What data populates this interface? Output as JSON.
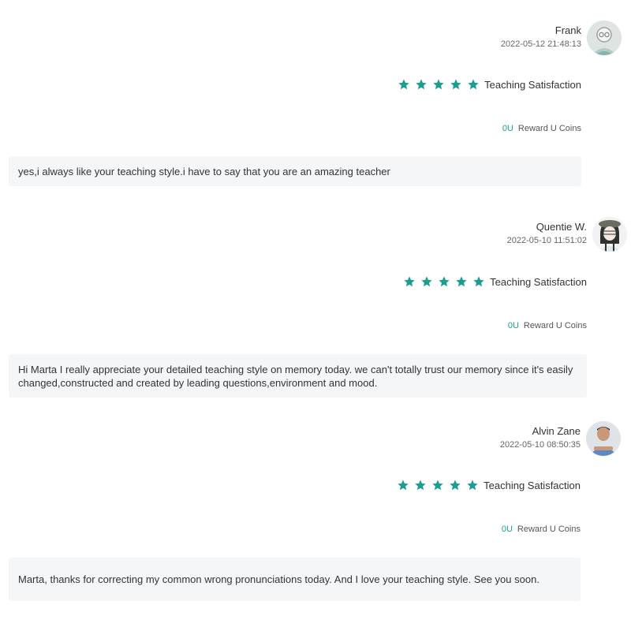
{
  "colors": {
    "accent": "#1a9e8f",
    "comment_bg": "#f5f6f8"
  },
  "reviews": [
    {
      "name": "Frank",
      "date": "2022-05-12 21:48:13",
      "avatar": "avatar-icon",
      "stars": 5,
      "rating_label": "Teaching Satisfaction",
      "reward_amount": "0U",
      "reward_label": "Reward U Coins",
      "comment": "yes,i always like your teaching style.i have to say that you are an amazing teacher"
    },
    {
      "name": "Quentie W.",
      "date": "2022-05-10 11:51:02",
      "avatar": "avatar-icon",
      "stars": 5,
      "rating_label": "Teaching Satisfaction",
      "reward_amount": "0U",
      "reward_label": "Reward U Coins",
      "comment": "Hi Marta I really appreciate your detailed teaching style on memory today. we can't totally trust our memory since it's easily changed,constructed and created by leading questions,environment and mood."
    },
    {
      "name": "Alvin Zane",
      "date": "2022-05-10 08:50:35",
      "avatar": "avatar-icon",
      "stars": 5,
      "rating_label": "Teaching Satisfaction",
      "reward_amount": "0U",
      "reward_label": "Reward U Coins",
      "comment": "Marta, thanks for correcting my common wrong pronunciations today. And I love your teaching style. See you soon."
    }
  ]
}
